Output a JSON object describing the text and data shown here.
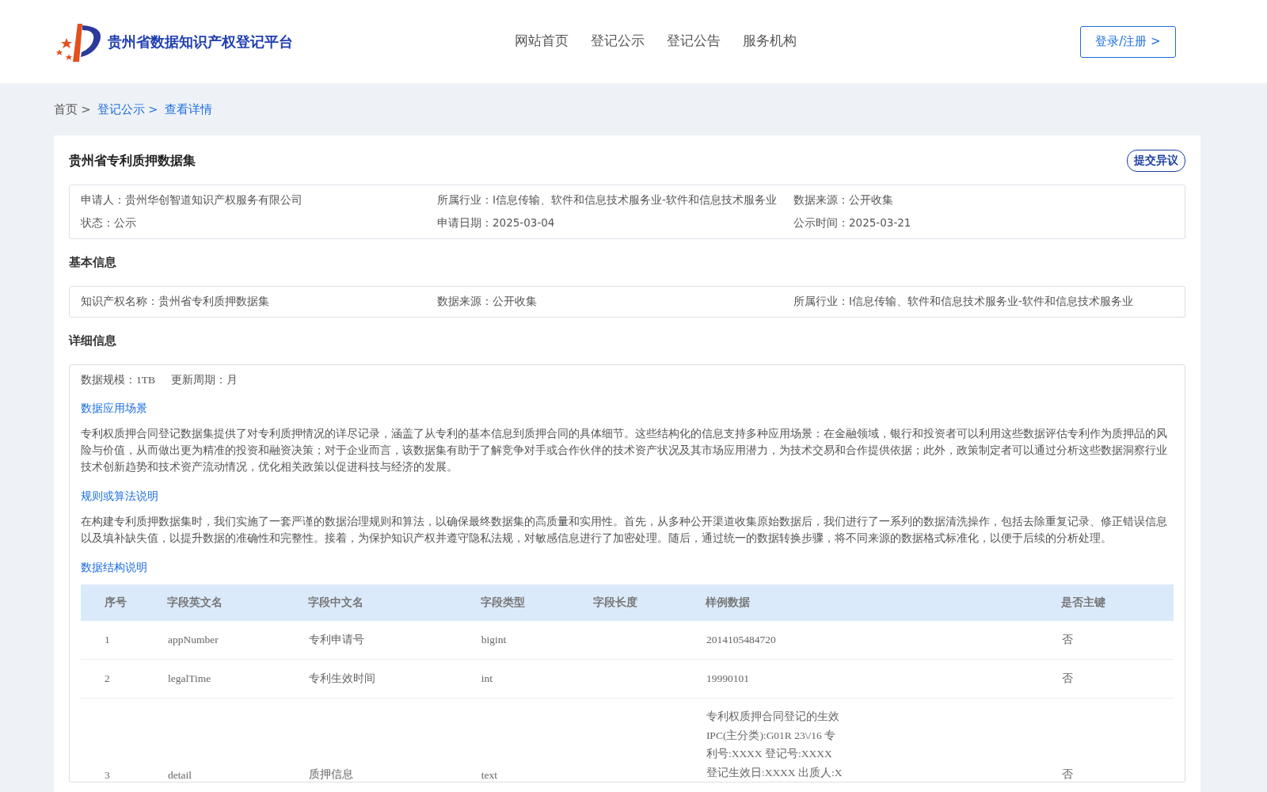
{
  "header": {
    "site_title": "贵州省数据知识产权登记平台",
    "nav": [
      {
        "label": "网站首页",
        "selected": false
      },
      {
        "label": "登记公示",
        "selected": false
      },
      {
        "label": "登记公告",
        "selected": false
      },
      {
        "label": "服务机构",
        "selected": false
      }
    ],
    "login_button": "登录/注册 >"
  },
  "breadcrumb": [
    {
      "label": "首页 >",
      "kind": "plain"
    },
    {
      "label": "登记公示 >",
      "kind": "link"
    },
    {
      "label": "查看详情",
      "kind": "link"
    }
  ],
  "title": "贵州省专利质押数据集",
  "objection_button": "提交异议",
  "summary": [
    {
      "label": "申请人：",
      "value": "贵州华创智道知识产权服务有限公司"
    },
    {
      "label": "所属行业：",
      "value": "I信息传输、软件和信息技术服务业-软件和信息技术服务业"
    },
    {
      "label": "数据来源：",
      "value": "公开收集"
    },
    {
      "label": "状态：",
      "value": "公示"
    },
    {
      "label": "申请日期：",
      "value": "2025-03-04"
    },
    {
      "label": "公示时间：",
      "value": "2025-03-21"
    }
  ],
  "basic_info": {
    "heading": "基本信息",
    "fields": [
      {
        "label": "知识产权名称：",
        "value": "贵州省专利质押数据集"
      },
      {
        "label": "数据来源：",
        "value": "公开收集"
      },
      {
        "label": "所属行业：",
        "value": "I信息传输、软件和信息技术服务业-软件和信息技术服务业"
      }
    ]
  },
  "detail_info": {
    "heading": "详细信息",
    "meta": [
      {
        "label": "数据规模：",
        "value": "1TB"
      },
      {
        "label": "更新周期：",
        "value": "月"
      }
    ],
    "sections": [
      {
        "heading": "数据应用场景",
        "text": "专利权质押合同登记数据集提供了对专利质押情况的详尽记录，涵盖了从专利的基本信息到质押合同的具体细节。这些结构化的信息支持多种应用场景：在金融领域，银行和投资者可以利用这些数据评估专利作为质押品的风险与价值，从而做出更为精准的投资和融资决策；对于企业而言，该数据集有助于了解竞争对手或合作伙伴的技术资产状况及其市场应用潜力，为技术交易和合作提供依据；此外，政策制定者可以通过分析这些数据洞察行业技术创新趋势和技术资产流动情况，优化相关政策以促进科技与经济的发展。"
      },
      {
        "heading": "规则或算法说明",
        "text": "在构建专利质押数据集时，我们实施了一套严谨的数据治理规则和算法，以确保最终数据集的高质量和实用性。首先，从多种公开渠道收集原始数据后，我们进行了一系列的数据清洗操作，包括去除重复记录、修正错误信息以及填补缺失值，以提升数据的准确性和完整性。接着，为保护知识产权并遵守隐私法规，对敏感信息进行了加密处理。随后，通过统一的数据转换步骤，将不同来源的数据格式标准化，以便于后续的分析处理。"
      },
      {
        "heading": "数据结构说明"
      }
    ],
    "table": {
      "columns": [
        "序号",
        "字段英文名",
        "字段中文名",
        "字段类型",
        "字段长度",
        "样例数据",
        "是否主键"
      ],
      "rows": [
        [
          "1",
          "appNumber",
          "专利申请号",
          "bigint",
          "",
          "2014105484720",
          "否"
        ],
        [
          "2",
          "legalTime",
          "专利生效时间",
          "int",
          "",
          "19990101",
          "否"
        ],
        [
          "3",
          "detail",
          "质押信息",
          "text",
          "",
          "专利权质押合同登记的生效IPC(主分类):G01R 23\\/16 专利号:XXXX 登记号:XXXX 登记生效日:XXXX 出质人:X",
          "否"
        ]
      ]
    }
  }
}
